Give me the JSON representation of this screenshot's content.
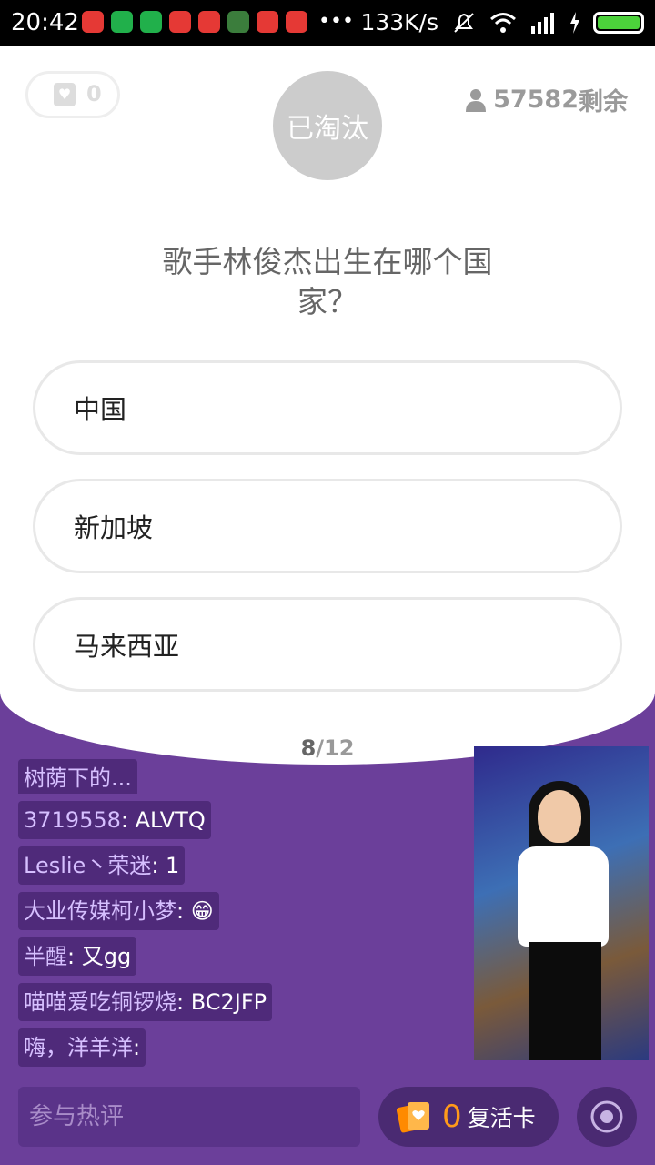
{
  "status_bar": {
    "time": "20:42",
    "net_speed": "133K/s",
    "more_dots": "•••"
  },
  "quiz": {
    "lives_count": "0",
    "status_label": "已淘汰",
    "remaining_count": "57582",
    "remaining_label": "剩余",
    "question": "歌手林俊杰出生在哪个国家？",
    "options": [
      "中国",
      "新加坡",
      "马来西亚"
    ],
    "progress_current": "8",
    "progress_total": "/12"
  },
  "chat": {
    "first_partial": "树荫下的..."
  },
  "chat_messages": [
    {
      "user": "3719558",
      "text": "ALVTQ"
    },
    {
      "user": "Leslie丶荣迷",
      "text": "1"
    },
    {
      "user": "大业传媒柯小梦",
      "text": "😁"
    },
    {
      "user": "半醒",
      "text": "又gg"
    },
    {
      "user": "喵喵爱吃铜锣烧",
      "text": "BC2JFP"
    },
    {
      "user": "嗨，洋羊洋",
      "text": ""
    }
  ],
  "bottom": {
    "comment_placeholder": "参与热评",
    "revive_count": "0",
    "revive_label": "复活卡"
  },
  "colors": {
    "background": "#6b3f9a",
    "accent_orange": "#ff9a1a"
  }
}
